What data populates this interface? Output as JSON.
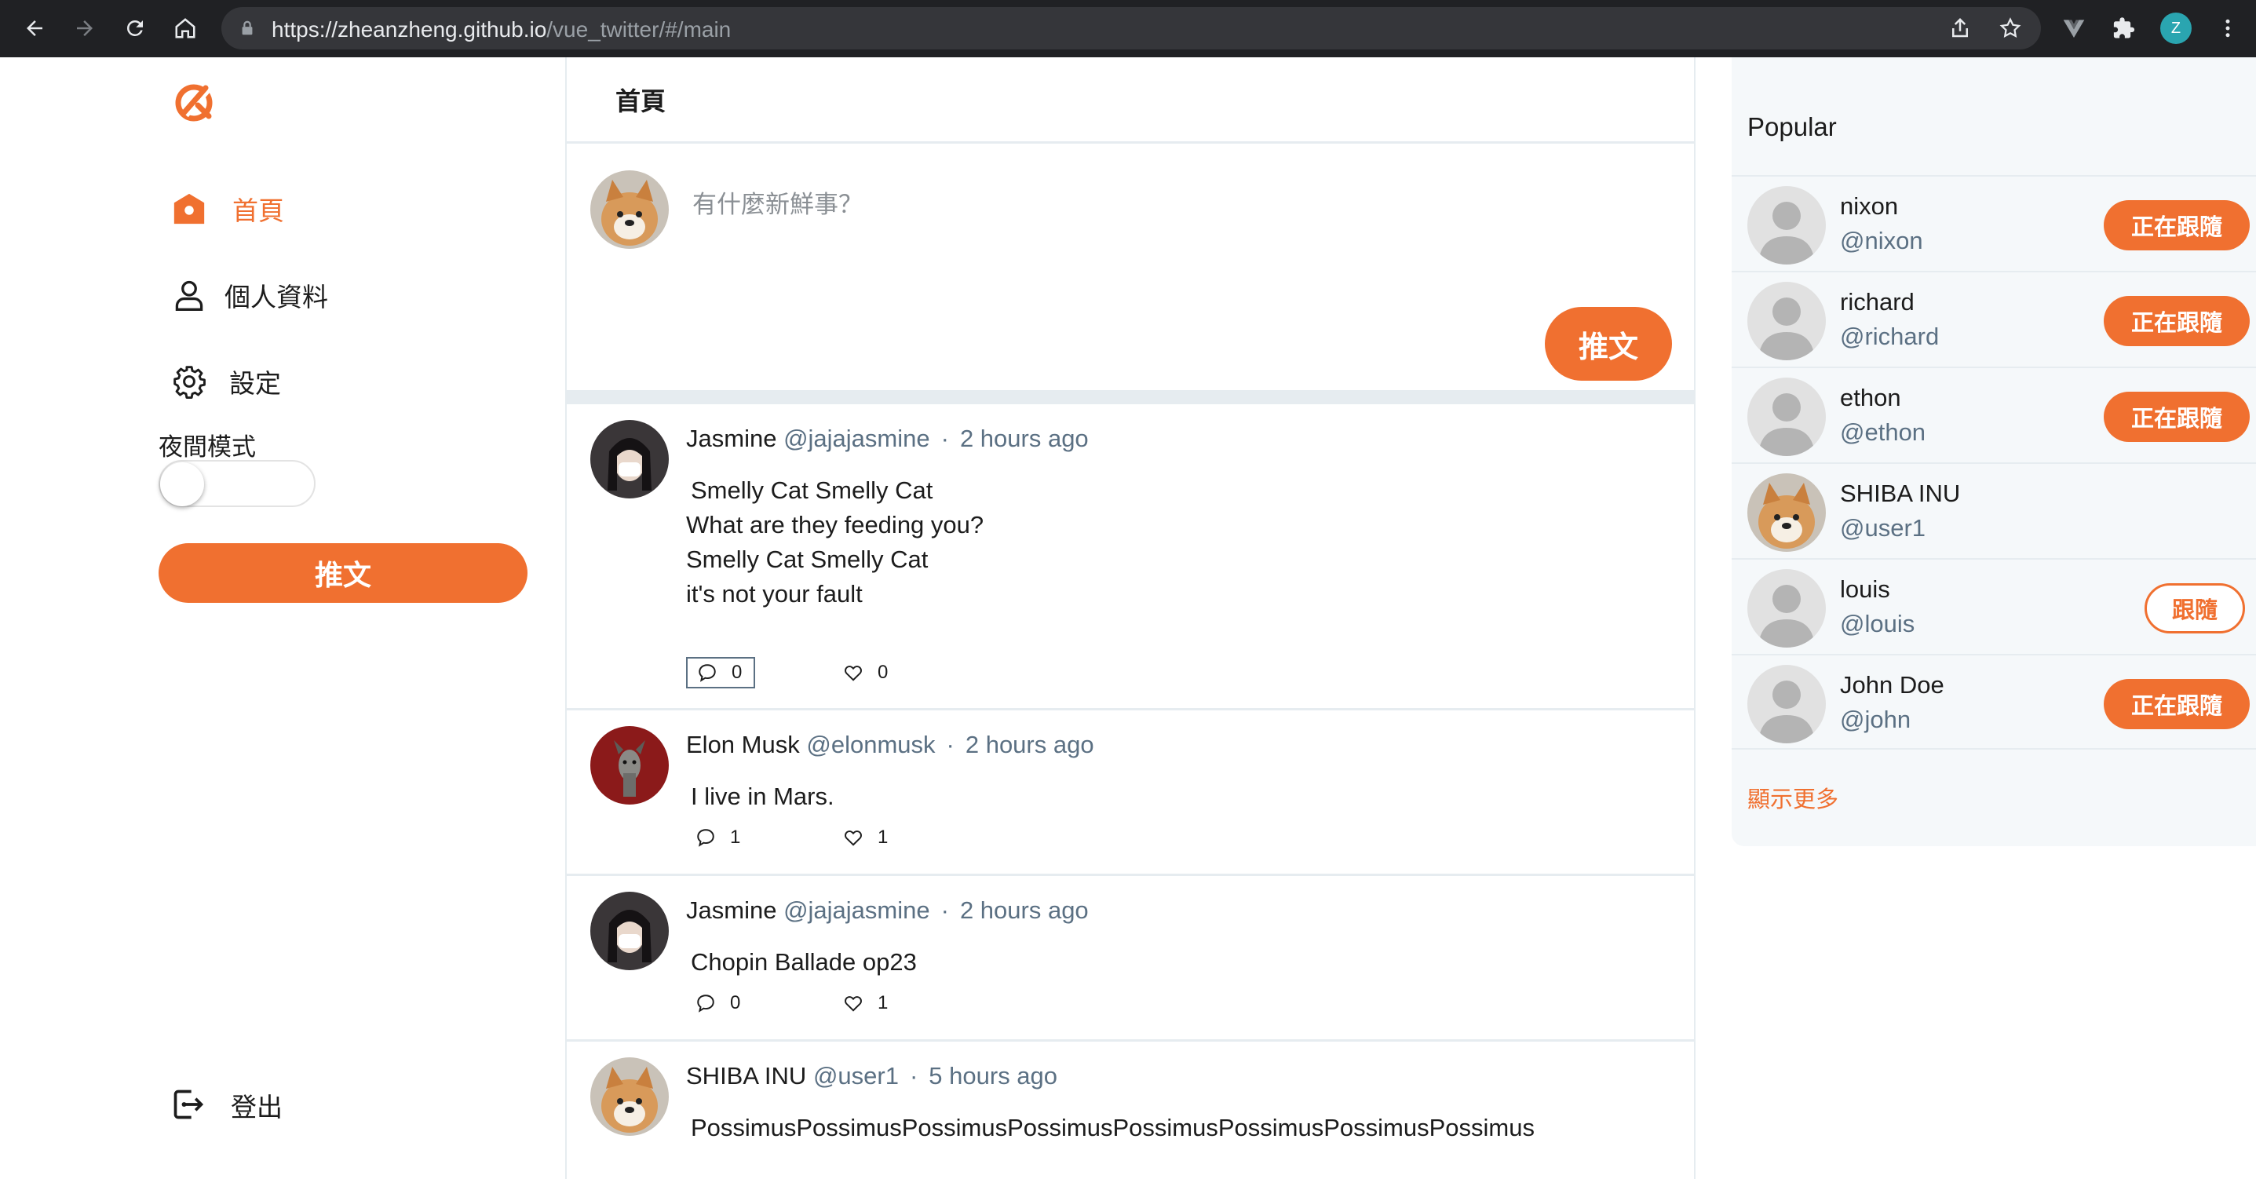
{
  "browser": {
    "url_host": "https://zheanzheng.github.io",
    "url_path": "/vue_twitter/#/main",
    "profile_initial": "Z"
  },
  "sidebar": {
    "items": [
      {
        "label": "首頁",
        "icon": "home-icon",
        "active": true
      },
      {
        "label": "個人資料",
        "icon": "user-icon",
        "active": false
      },
      {
        "label": "設定",
        "icon": "gear-icon",
        "active": false
      }
    ],
    "night_mode_label": "夜間模式",
    "night_mode_on": false,
    "tweet_button": "推文",
    "logout_label": "登出"
  },
  "main": {
    "header_title": "首頁",
    "composer": {
      "placeholder": "有什麼新鮮事？",
      "tweet_button": "推文"
    },
    "tweets": [
      {
        "name": "Jasmine",
        "handle": "@jajajasmine",
        "time": "2 hours ago",
        "lines": [
          "Smelly Cat Smelly Cat",
          "What are they feeding you?",
          "Smelly Cat Smelly Cat",
          "it's not your fault"
        ],
        "replies": "0",
        "likes": "0"
      },
      {
        "name": "Elon Musk",
        "handle": "@elonmusk",
        "time": "2 hours ago",
        "lines": [
          "I live in Mars."
        ],
        "replies": "1",
        "likes": "1"
      },
      {
        "name": "Jasmine",
        "handle": "@jajajasmine",
        "time": "2 hours ago",
        "lines": [
          "Chopin Ballade op23"
        ],
        "replies": "0",
        "likes": "1"
      },
      {
        "name": "SHIBA INU",
        "handle": "@user1",
        "time": "5 hours ago",
        "lines": [
          "PossimusPossimusPossimusPossimusPossimusPossimusPossimusPossimus"
        ]
      }
    ]
  },
  "popular": {
    "title": "Popular",
    "users": [
      {
        "name": "nixon",
        "handle": "@nixon",
        "button": "正在跟隨"
      },
      {
        "name": "richard",
        "handle": "@richard",
        "button": "正在跟隨"
      },
      {
        "name": "ethon",
        "handle": "@ethon",
        "button": "正在跟隨"
      },
      {
        "name": "SHIBA INU",
        "handle": "@user1",
        "button": ""
      },
      {
        "name": "louis",
        "handle": "@louis",
        "button": "跟隨"
      },
      {
        "name": "John Doe",
        "handle": "@john",
        "button": "正在跟隨"
      }
    ],
    "show_more": "顯示更多"
  },
  "colors": {
    "accent": "#f07030",
    "muted": "#5b7083",
    "divider": "#e6ecf0"
  }
}
